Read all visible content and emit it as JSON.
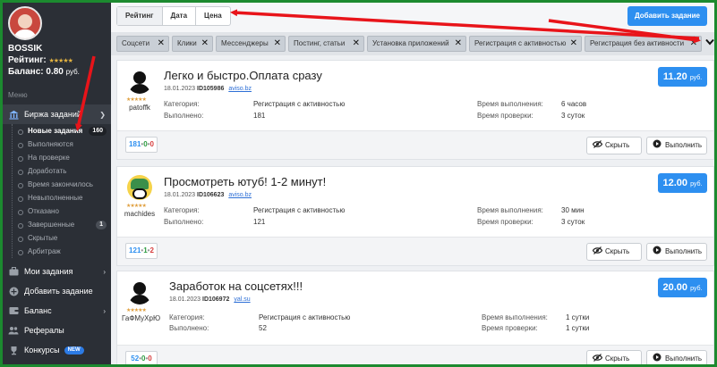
{
  "user": {
    "name": "BOSSIK",
    "rating_label": "Рейтинг:",
    "rating_stars": "★★★★★",
    "balance_label": "Баланс:",
    "balance_value": "0.80",
    "balance_currency": "руб."
  },
  "sidebar": {
    "menu_caption": "Меню",
    "exchange_label": "Биржа заданий",
    "sub_items": [
      {
        "label": "Новые задания",
        "count": "160"
      },
      {
        "label": "Выполняются"
      },
      {
        "label": "На проверке"
      },
      {
        "label": "Доработать"
      },
      {
        "label": "Время закончилось"
      },
      {
        "label": "Невыполненные"
      },
      {
        "label": "Отказано"
      },
      {
        "label": "Завершенные",
        "count": "1"
      },
      {
        "label": "Скрытые"
      },
      {
        "label": "Арбитраж"
      }
    ],
    "main_items": [
      {
        "label": "Мои задания"
      },
      {
        "label": "Добавить задание"
      },
      {
        "label": "Баланс"
      },
      {
        "label": "Рефералы"
      },
      {
        "label": "Конкурсы",
        "badge": "NEW"
      }
    ]
  },
  "topbar": {
    "sort_rating": "Рейтинг",
    "sort_date": "Дата",
    "sort_price": "Цена",
    "add_task": "Добавить задание"
  },
  "filters": [
    "Соцсети",
    "Клики",
    "Мессенджеры",
    "Постинг, статьи",
    "Установка приложений",
    "Регистрация с активностью",
    "Регистрация без активности"
  ],
  "labels": {
    "category": "Категория:",
    "done": "Выполнено:",
    "exec_time": "Время выполнения:",
    "check_time": "Время проверки:",
    "hide": "Скрыть",
    "run": "Выполнить",
    "currency": "руб."
  },
  "tasks": [
    {
      "login": "patoffk",
      "title": "Легко и быстро.Оплата сразу",
      "date": "18.01.2023",
      "id": "ID105986",
      "source": "aviso.bz",
      "price": "11.20",
      "category": "Регистрация с активностью",
      "done": "181",
      "exec_time": "6 часов",
      "check_time": "3 суток",
      "stat_ok": "181",
      "stat_wait": "0",
      "stat_bad": "0"
    },
    {
      "login": "machides",
      "title": "Просмотреть ютуб! 1-2 минут!",
      "date": "18.01.2023",
      "id": "ID106623",
      "source": "aviso.bz",
      "price": "12.00",
      "category": "Регистрация с активностью",
      "done": "121",
      "exec_time": "30 мин",
      "check_time": "3 суток",
      "stat_ok": "121",
      "stat_wait": "1",
      "stat_bad": "2"
    },
    {
      "login": "ГаФМуХрЮ",
      "title": "Заработок на соцсетях!!!",
      "date": "18.01.2023",
      "id": "ID106972",
      "source": "yal.su",
      "price": "20.00",
      "category": "Регистрация с активностью",
      "done": "52",
      "exec_time": "1 сутки",
      "check_time": "1 сутки",
      "stat_ok": "52",
      "stat_wait": "0",
      "stat_bad": "0"
    }
  ]
}
